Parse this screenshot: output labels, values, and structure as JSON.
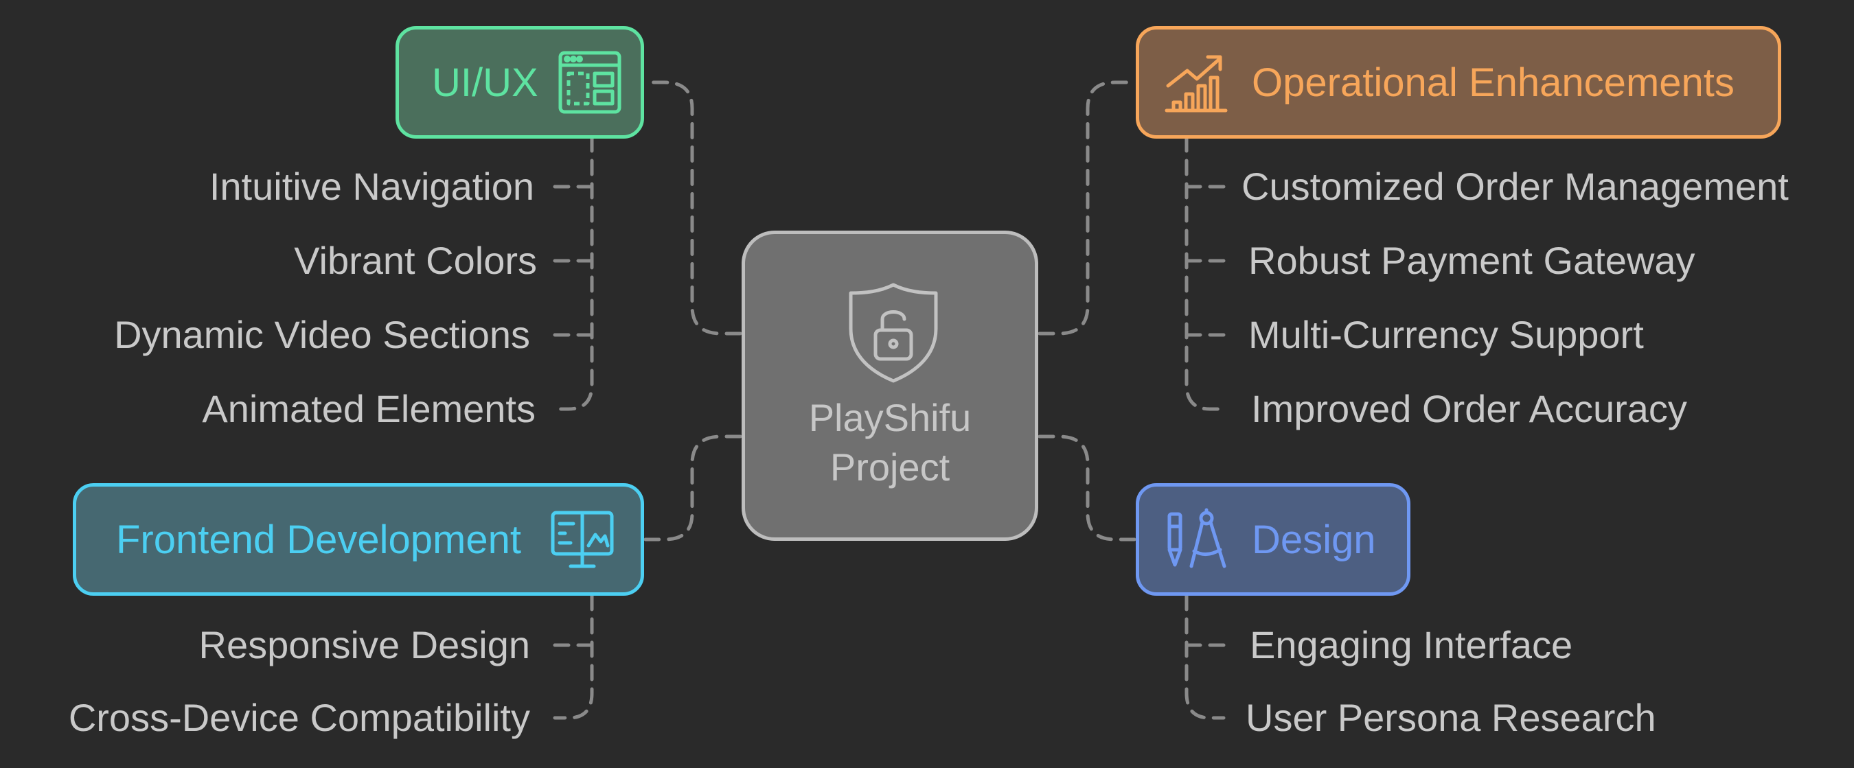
{
  "center": {
    "title_line1": "PlayShifu",
    "title_line2": "Project",
    "icon": "shield-lock-icon"
  },
  "branches": {
    "uiux": {
      "label": "UI/UX",
      "icon": "layout-grid-icon",
      "color": "#5ee3a1",
      "fill": "#4b6f5c",
      "items": [
        "Intuitive Navigation",
        "Vibrant Colors",
        "Dynamic Video Sections",
        "Animated Elements"
      ]
    },
    "operational": {
      "label": "Operational Enhancements",
      "icon": "growth-chart-icon",
      "color": "#f7a65a",
      "fill": "#7d5e47",
      "items": [
        "Customized Order Management",
        "Robust Payment Gateway",
        "Multi-Currency Support",
        "Improved Order Accuracy"
      ]
    },
    "frontend": {
      "label": "Frontend Development",
      "icon": "monitor-icon",
      "color": "#4ccff2",
      "fill": "#466871",
      "items": [
        "Responsive Design",
        "Cross-Device Compatibility"
      ]
    },
    "design": {
      "label": "Design",
      "icon": "compass-pen-icon",
      "color": "#6f98f2",
      "fill": "#4d5f82",
      "items": [
        "Engaging Interface",
        "User Persona Research"
      ]
    }
  }
}
